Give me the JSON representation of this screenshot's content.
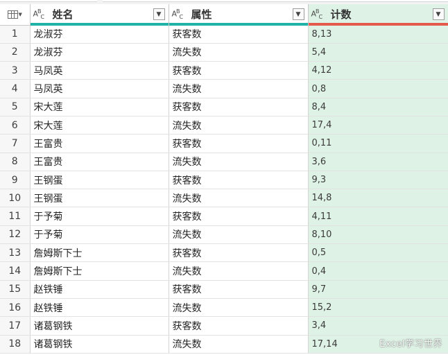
{
  "columns": [
    {
      "name": "姓名",
      "type_icon": "ABC"
    },
    {
      "name": "属性",
      "type_icon": "ABC"
    },
    {
      "name": "计数",
      "type_icon": "ABC"
    }
  ],
  "colors": {
    "header_accent": "#1fb3a8",
    "selected_column_accent": "#e55a4e",
    "selected_column_bg": "#dff2e6"
  },
  "rows": [
    {
      "index": "1",
      "name": "龙淑芬",
      "attr": "获客数",
      "count": "8,13"
    },
    {
      "index": "2",
      "name": "龙淑芬",
      "attr": "流失数",
      "count": "5,4"
    },
    {
      "index": "3",
      "name": "马凤英",
      "attr": "获客数",
      "count": "4,12"
    },
    {
      "index": "4",
      "name": "马凤英",
      "attr": "流失数",
      "count": "0,8"
    },
    {
      "index": "5",
      "name": "宋大莲",
      "attr": "获客数",
      "count": "8,4"
    },
    {
      "index": "6",
      "name": "宋大莲",
      "attr": "流失数",
      "count": "17,4"
    },
    {
      "index": "7",
      "name": "王富贵",
      "attr": "获客数",
      "count": "0,11"
    },
    {
      "index": "8",
      "name": "王富贵",
      "attr": "流失数",
      "count": "3,6"
    },
    {
      "index": "9",
      "name": "王钢蛋",
      "attr": "获客数",
      "count": "9,3"
    },
    {
      "index": "10",
      "name": "王钢蛋",
      "attr": "流失数",
      "count": "14,8"
    },
    {
      "index": "11",
      "name": "于予菊",
      "attr": "获客数",
      "count": "4,11"
    },
    {
      "index": "12",
      "name": "于予菊",
      "attr": "流失数",
      "count": "8,10"
    },
    {
      "index": "13",
      "name": "詹姆斯下士",
      "attr": "获客数",
      "count": "0,5"
    },
    {
      "index": "14",
      "name": "詹姆斯下士",
      "attr": "流失数",
      "count": "0,4"
    },
    {
      "index": "15",
      "name": "赵铁锤",
      "attr": "获客数",
      "count": "9,7"
    },
    {
      "index": "16",
      "name": "赵铁锤",
      "attr": "流失数",
      "count": "15,2"
    },
    {
      "index": "17",
      "name": "诸葛钢铁",
      "attr": "获客数",
      "count": "3,4"
    },
    {
      "index": "18",
      "name": "诸葛钢铁",
      "attr": "流失数",
      "count": "17,14"
    }
  ],
  "watermark": "Excel学习世界"
}
